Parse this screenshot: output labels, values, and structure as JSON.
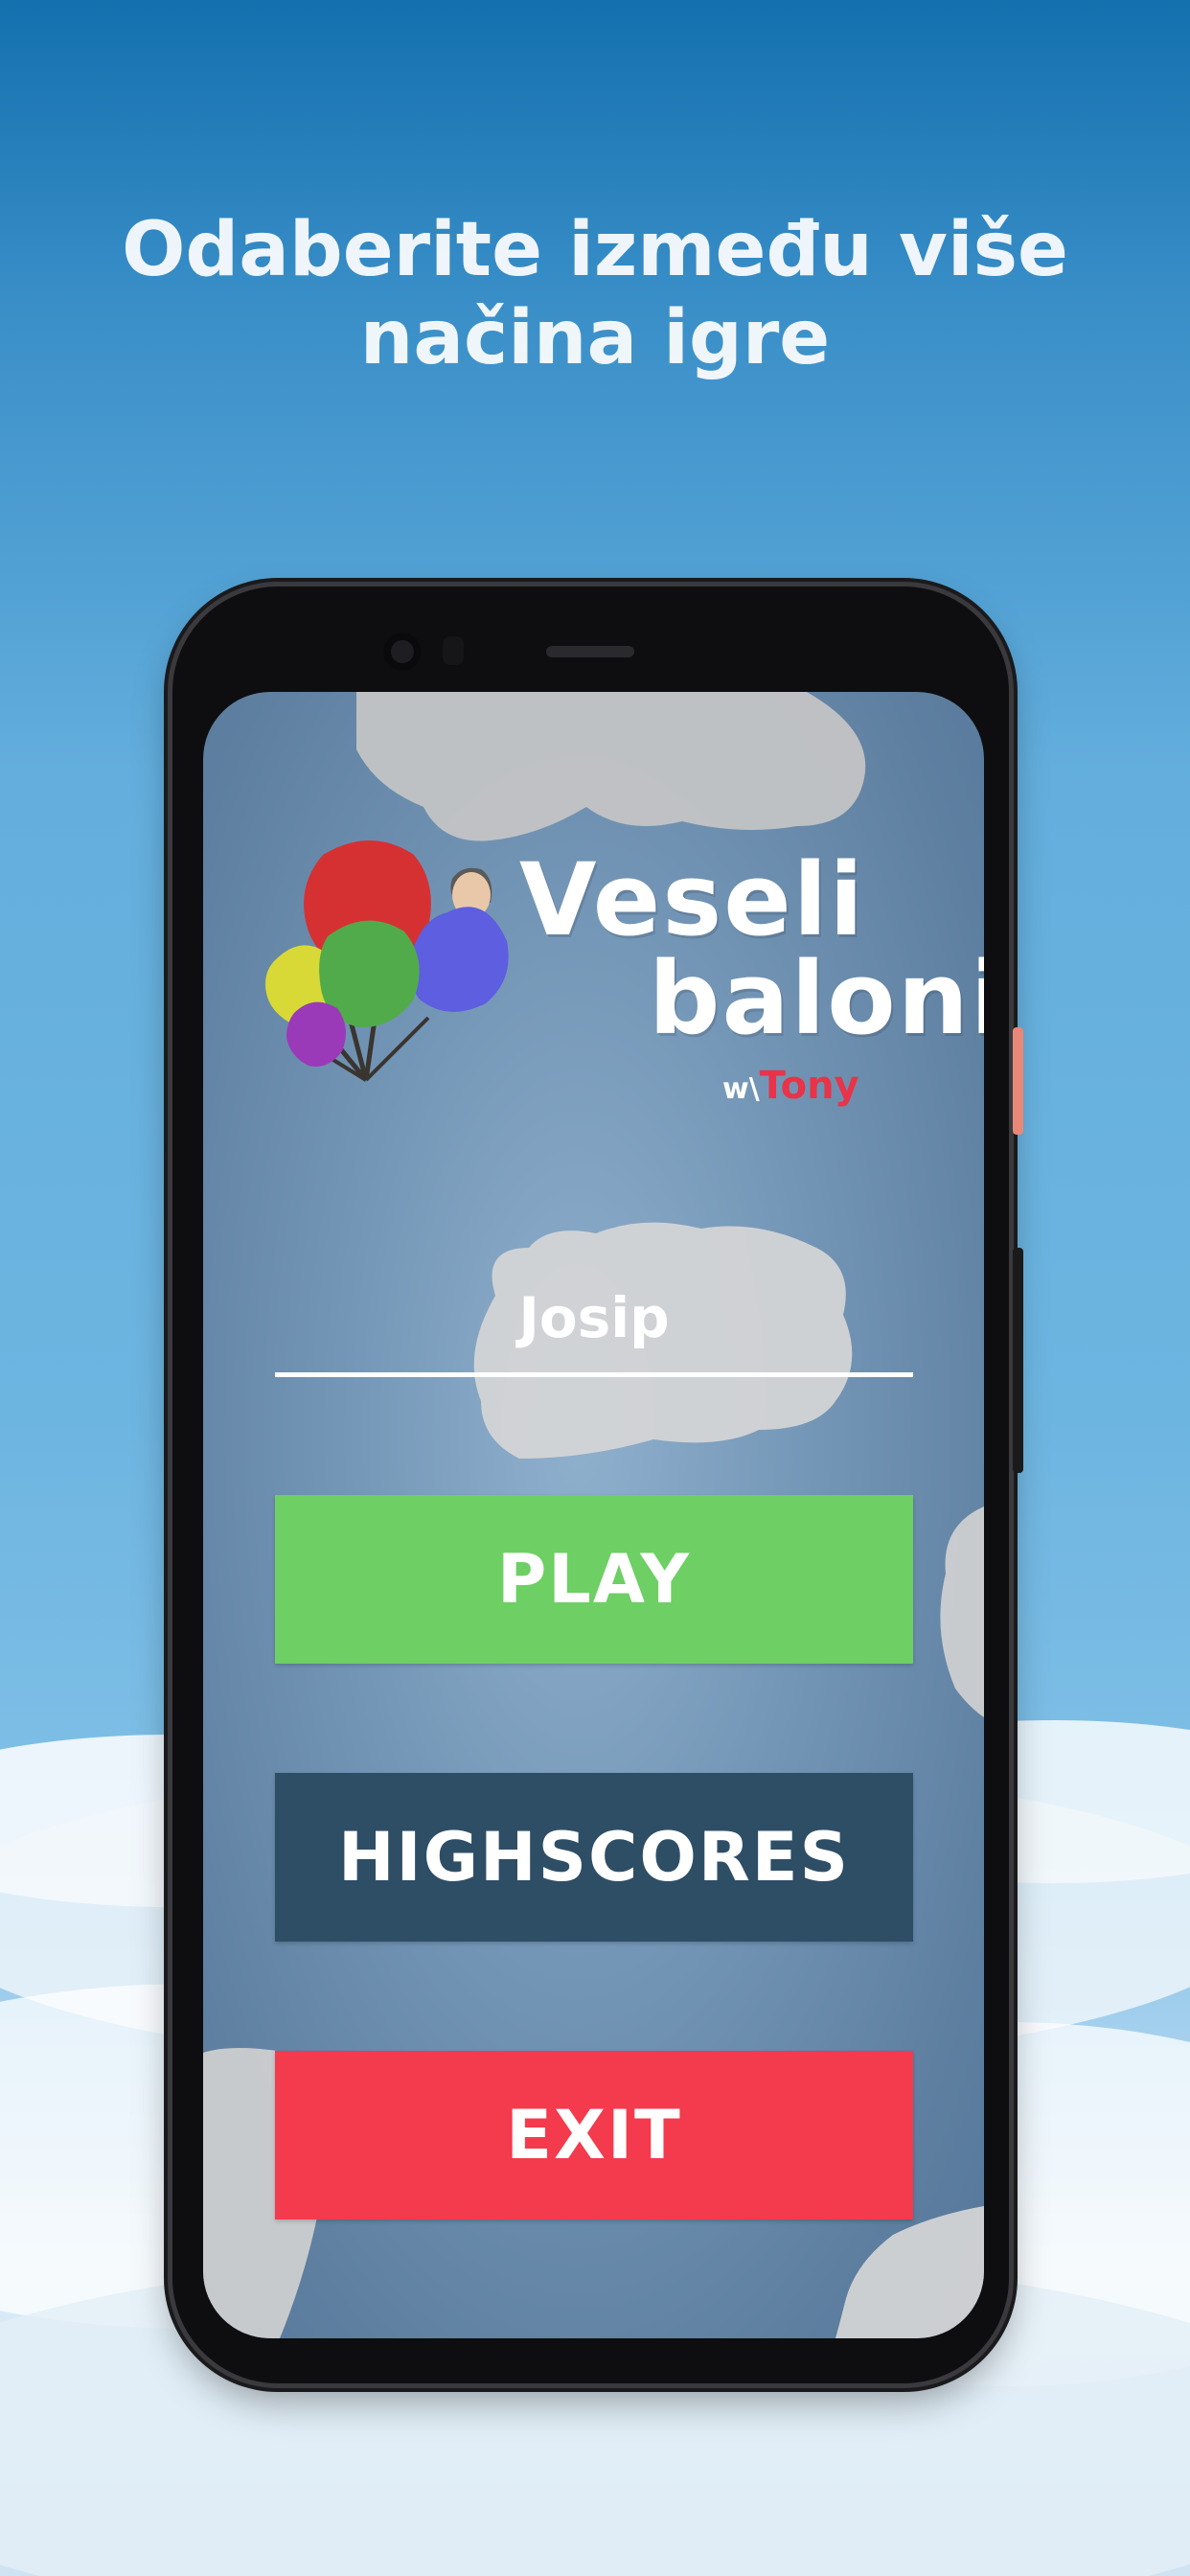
{
  "promo": {
    "title": "Odaberite između više načina igre"
  },
  "colors": {
    "sky_top": "#1470ae",
    "sky_mid": "#6db5e1",
    "screen_bg": "#7597b7",
    "play": "#6dcf64",
    "highscores": "#2e4e66",
    "exit": "#f43a4d",
    "accent_red": "#e83349"
  },
  "app": {
    "logo_line1": "Veseli",
    "logo_line2": "baloni",
    "logo_prefix": "w\\",
    "logo_name": "Tony",
    "logo_image": "balloons-with-face-icon"
  },
  "form": {
    "name_value": "Josip"
  },
  "buttons": {
    "play": "PLAY",
    "highscores": "HIGHSCORES",
    "exit": "EXIT"
  }
}
